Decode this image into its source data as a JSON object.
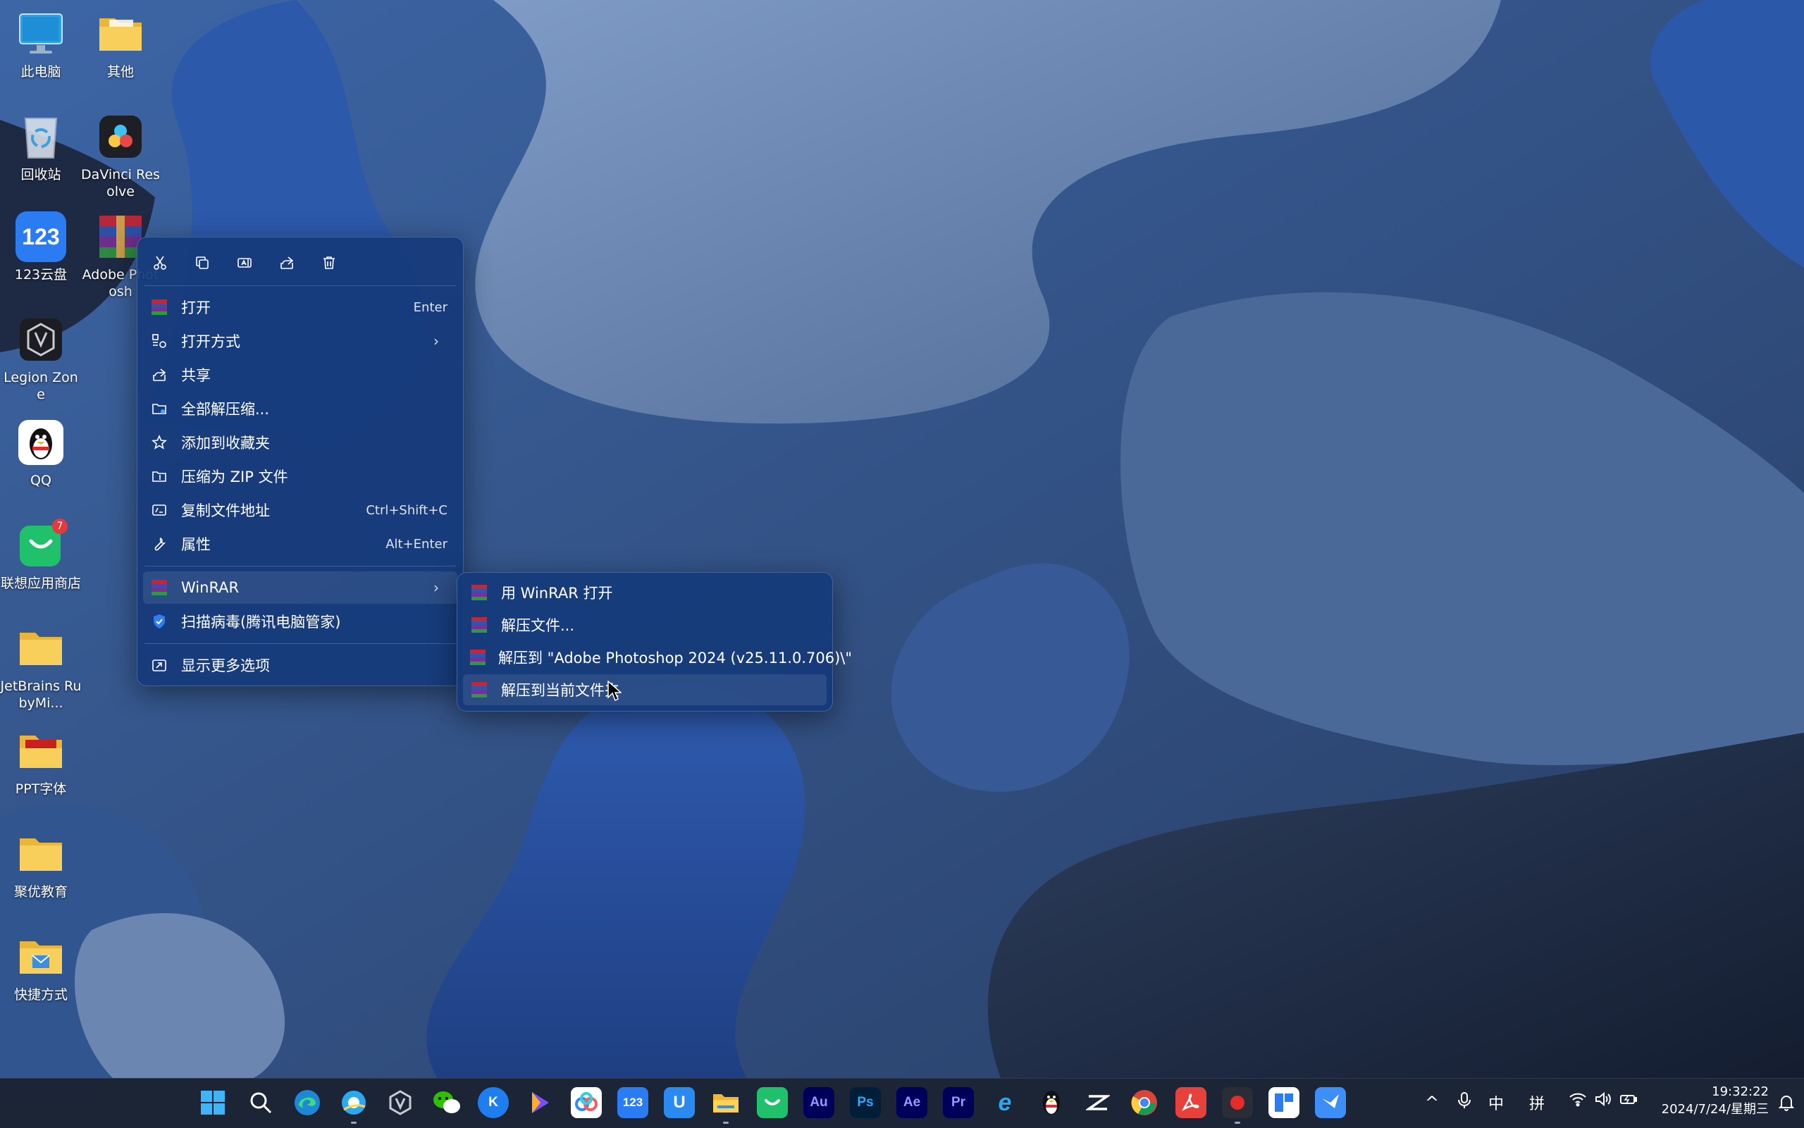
{
  "desktop": {
    "icons": [
      {
        "id": "this-pc",
        "label": "此电脑"
      },
      {
        "id": "other-folder",
        "label": "其他"
      },
      {
        "id": "recycle-bin",
        "label": "回收站"
      },
      {
        "id": "davinci",
        "label": "DaVinci Resolve"
      },
      {
        "id": "yun123",
        "label": "123云盘",
        "glyph": "123"
      },
      {
        "id": "adobe-ps-archive",
        "label": "Adobe Photosh"
      },
      {
        "id": "legion-zone",
        "label": "Legion Zone"
      },
      {
        "id": "qq",
        "label": "QQ"
      },
      {
        "id": "lenovo-store",
        "label": "联想应用商店",
        "badge": "7"
      },
      {
        "id": "jetbrains-rubymine",
        "label": "JetBrains RubyMi..."
      },
      {
        "id": "ppt-fonts",
        "label": "PPT字体"
      },
      {
        "id": "juyou-edu",
        "label": "聚优教育"
      },
      {
        "id": "shortcuts",
        "label": "快捷方式"
      }
    ]
  },
  "context_menu": {
    "toolbar": [
      "cut-icon",
      "copy-icon",
      "rename-icon",
      "share-icon",
      "delete-icon"
    ],
    "items": [
      {
        "label": "打开",
        "shortcut": "Enter",
        "icon": "winrar-icon"
      },
      {
        "label": "打开方式",
        "icon": "open-with-icon",
        "arrow": "›"
      },
      {
        "label": "共享",
        "icon": "share-icon"
      },
      {
        "label": "全部解压缩...",
        "icon": "extract-all-icon"
      },
      {
        "label": "添加到收藏夹",
        "icon": "star-icon"
      },
      {
        "label": "压缩为 ZIP 文件",
        "icon": "zip-folder-icon"
      },
      {
        "label": "复制文件地址",
        "shortcut": "Ctrl+Shift+C",
        "icon": "copy-path-icon"
      },
      {
        "label": "属性",
        "shortcut": "Alt+Enter",
        "icon": "wrench-icon"
      },
      {
        "label": "WinRAR",
        "icon": "winrar-icon",
        "arrow": "›"
      },
      {
        "label": "扫描病毒(腾讯电脑管家)",
        "icon": "shield-icon"
      },
      {
        "label": "显示更多选项",
        "icon": "more-options-icon"
      }
    ]
  },
  "winrar_submenu": {
    "items": [
      {
        "label": "用 WinRAR 打开"
      },
      {
        "label": "解压文件..."
      },
      {
        "label": "解压到 \"Adobe Photoshop 2024 (v25.11.0.706)\\\""
      },
      {
        "label": "解压到当前文件夹"
      }
    ]
  },
  "taskbar": {
    "apps": [
      {
        "id": "start",
        "label": ""
      },
      {
        "id": "search",
        "label": ""
      },
      {
        "id": "edge",
        "label": ""
      },
      {
        "id": "qq-browser",
        "label": ""
      },
      {
        "id": "legion",
        "label": ""
      },
      {
        "id": "wechat",
        "label": ""
      },
      {
        "id": "kugou",
        "label": "K"
      },
      {
        "id": "video-editor",
        "label": ""
      },
      {
        "id": "baidu-netdisk",
        "label": ""
      },
      {
        "id": "yun123",
        "label": "123"
      },
      {
        "id": "u-app",
        "label": "U"
      },
      {
        "id": "file-explorer",
        "label": ""
      },
      {
        "id": "lenovo-store",
        "label": ""
      },
      {
        "id": "audition",
        "label": "Au"
      },
      {
        "id": "photoshop",
        "label": "Ps"
      },
      {
        "id": "after-effects",
        "label": "Ae"
      },
      {
        "id": "premiere",
        "label": "Pr"
      },
      {
        "id": "ie",
        "label": "e"
      },
      {
        "id": "qq",
        "label": ""
      },
      {
        "id": "capcut",
        "label": ""
      },
      {
        "id": "chrome",
        "label": ""
      },
      {
        "id": "acrobat",
        "label": ""
      },
      {
        "id": "recorder",
        "label": ""
      },
      {
        "id": "todesk",
        "label": ""
      },
      {
        "id": "feishu",
        "label": ""
      }
    ],
    "tray": {
      "chevron": "^",
      "ime_lang": "中",
      "ime_mode": "拼"
    },
    "clock": {
      "time": "19:32:22",
      "date": "2024/7/24/星期三"
    }
  }
}
